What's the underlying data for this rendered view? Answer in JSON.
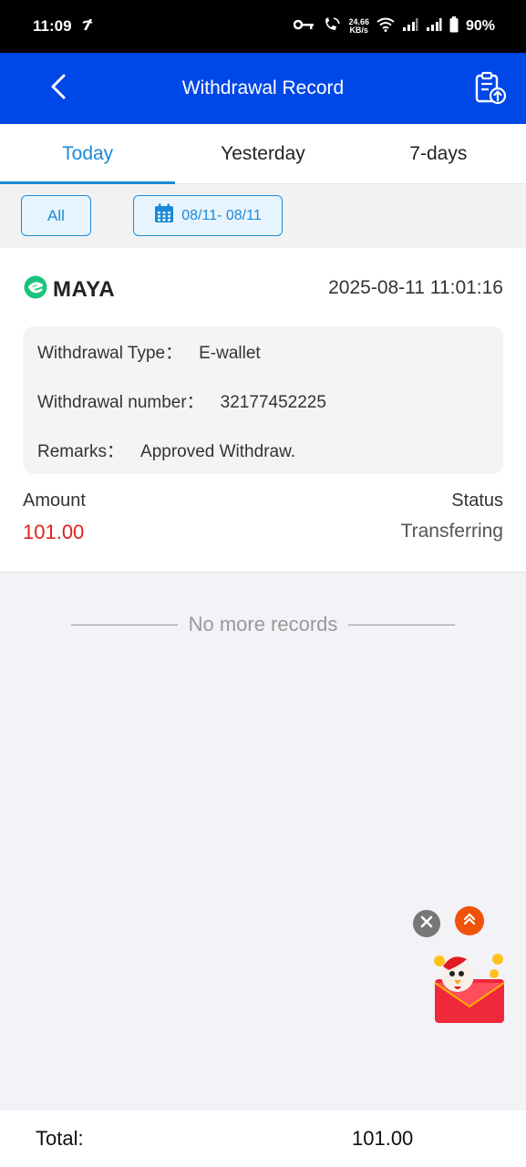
{
  "status_bar": {
    "time": "11:09",
    "net_speed_value": "24.66",
    "net_speed_unit": "KB/s",
    "battery": "90%"
  },
  "header": {
    "title": "Withdrawal Record"
  },
  "tabs": [
    {
      "label": "Today",
      "active": true
    },
    {
      "label": "Yesterday",
      "active": false
    },
    {
      "label": "7-days",
      "active": false
    }
  ],
  "filters": {
    "type_label": "All",
    "date_range": "08/11- 08/11"
  },
  "record": {
    "provider": "MAYA",
    "datetime": "2025-08-11 11:01:16",
    "withdrawal_type_label": "Withdrawal Type：",
    "withdrawal_type_value": "E-wallet",
    "withdrawal_number_label": "Withdrawal number：",
    "withdrawal_number_value": "32177452225",
    "remarks_label": "Remarks：",
    "remarks_value": "Approved Withdraw.",
    "amount_label": "Amount",
    "amount_value": "101.00",
    "status_label": "Status",
    "status_value": "Transferring"
  },
  "list_end_text": "No more records",
  "footer": {
    "total_label": "Total:",
    "total_value": "101.00"
  },
  "colors": {
    "header_bg": "#0047e8",
    "accent": "#1a8ad8",
    "amount": "#e02020",
    "maya_green": "#1bc47d"
  },
  "icons": {
    "back": "chevron-left-icon",
    "export": "clipboard-upload-icon",
    "calendar": "calendar-icon",
    "close": "close-icon",
    "scroll_top": "double-chevron-up-icon"
  }
}
